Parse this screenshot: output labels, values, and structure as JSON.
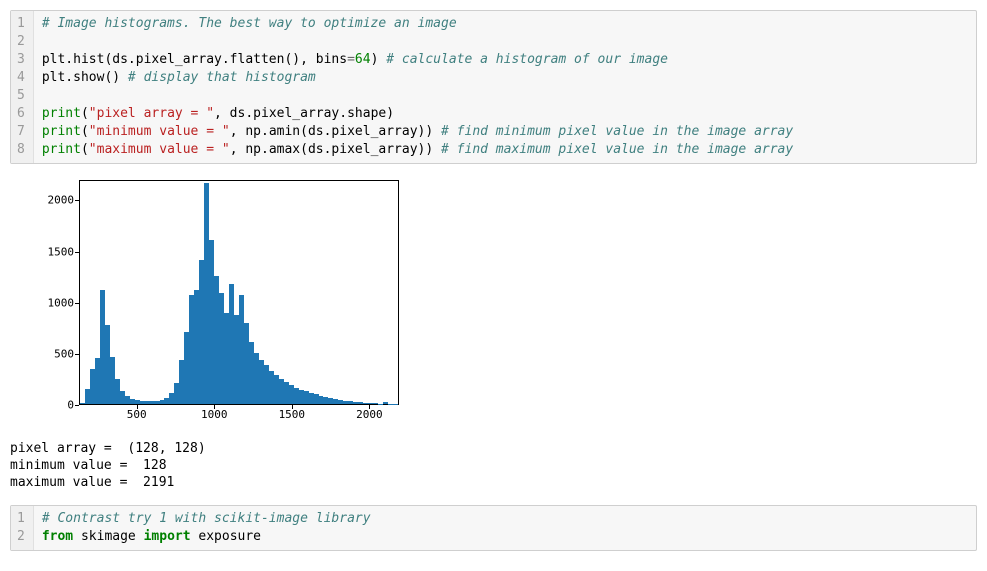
{
  "cell1": {
    "lines": [
      "1",
      "2",
      "3",
      "4",
      "5",
      "6",
      "7",
      "8"
    ],
    "l1_comment": "# Image histograms. The best way to optimize an image",
    "l3_a": "plt.hist(ds.pixel_array.flatten(), bins",
    "l3_eq": "=",
    "l3_num": "64",
    "l3_b": ") ",
    "l3_comment": "# calculate a histogram of our image",
    "l4_a": "plt.show() ",
    "l4_comment": "# display that histogram",
    "l6_a": "print",
    "l6_p1": "(",
    "l6_str": "\"pixel array = \"",
    "l6_b": ", ds.pixel_array.shape)",
    "l7_a": "print",
    "l7_p1": "(",
    "l7_str": "\"minimum value = \"",
    "l7_b": ", np.amin(ds.pixel_array)) ",
    "l7_comment": "# find minimum pixel value in the image array",
    "l8_a": "print",
    "l8_p1": "(",
    "l8_str": "\"maximum value = \"",
    "l8_b": ", np.amax(ds.pixel_array)) ",
    "l8_comment": "# find maximum pixel value in the image array"
  },
  "chart_data": {
    "type": "bar",
    "title": "",
    "xlabel": "",
    "ylabel": "",
    "xlim": [
      128,
      2191
    ],
    "ylim": [
      0,
      2200
    ],
    "x_ticks": [
      500,
      1000,
      1500,
      2000
    ],
    "y_ticks": [
      0,
      500,
      1000,
      1500,
      2000
    ],
    "bins": 64,
    "values": [
      10,
      150,
      350,
      450,
      1120,
      780,
      460,
      250,
      130,
      80,
      50,
      40,
      30,
      28,
      28,
      30,
      40,
      60,
      110,
      210,
      430,
      710,
      1080,
      1120,
      1420,
      2180,
      1620,
      1260,
      1100,
      900,
      1180,
      880,
      1080,
      800,
      610,
      500,
      430,
      380,
      330,
      290,
      250,
      220,
      190,
      160,
      140,
      125,
      110,
      95,
      80,
      68,
      58,
      48,
      40,
      32,
      26,
      20,
      16,
      12,
      8,
      6,
      4,
      16,
      2,
      1
    ]
  },
  "output_text": {
    "line1": "pixel array =  (128, 128)",
    "line2": "minimum value =  128",
    "line3": "maximum value =  2191"
  },
  "cell2": {
    "lines": [
      "1",
      "2"
    ],
    "l1_comment": "# Contrast try 1 with scikit-image library",
    "l2_from": "from",
    "l2_mod": " skimage ",
    "l2_import": "import",
    "l2_name": " exposure"
  }
}
